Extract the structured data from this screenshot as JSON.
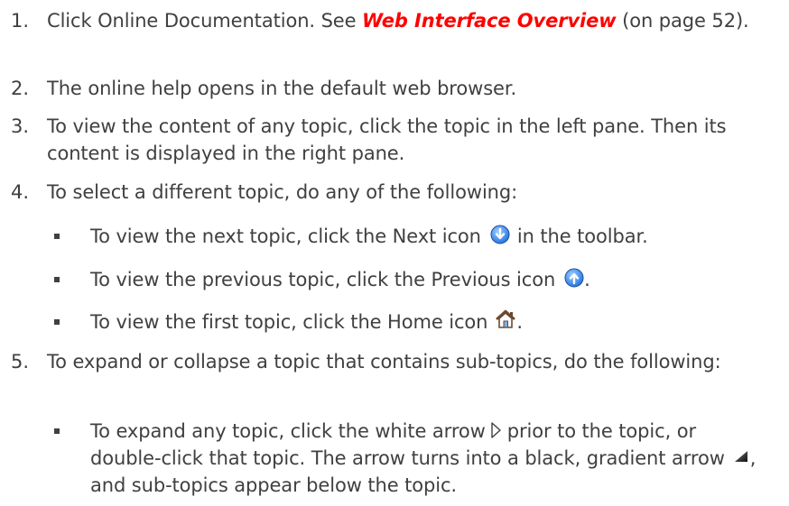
{
  "steps": [
    {
      "number": "1.",
      "before_link": "Click Online Documentation. See ",
      "link": "Web Interface Overview",
      "after_link": " (on page 52)."
    },
    {
      "number": "2.",
      "text": "The online help opens in the default web browser."
    },
    {
      "number": "3.",
      "text": "To view the content of any topic, click the topic in the left pane. Then its content is displayed in the right pane."
    },
    {
      "number": "4.",
      "text": "To select a different topic, do any of the following:",
      "bullets": [
        {
          "before_icon": "To view the next topic, click the Next icon",
          "icon": "next-icon",
          "after_icon": "in the toolbar."
        },
        {
          "before_icon": "To view the previous topic, click the Previous icon",
          "icon": "previous-icon",
          "after_icon": "."
        },
        {
          "before_icon": "To view the first topic, click the Home icon",
          "icon": "home-icon",
          "after_icon": "."
        }
      ]
    },
    {
      "number": "5.",
      "text": "To expand or collapse a topic that contains sub-topics, do the following:",
      "bullets": [
        {
          "part1": "To expand any topic, click the white arrow",
          "icon1": "white-arrow-icon",
          "part2": "prior to the topic, or double-click that topic. The arrow turns into a black, gradient arrow",
          "icon2": "black-gradient-arrow-icon",
          "part3": ", and sub-topics appear below the topic."
        }
      ]
    }
  ],
  "colors": {
    "text": "#404040",
    "link": "#ff0000",
    "nav_icon_fill": "#1f6fe0",
    "home_icon": "#6b4a2f"
  }
}
